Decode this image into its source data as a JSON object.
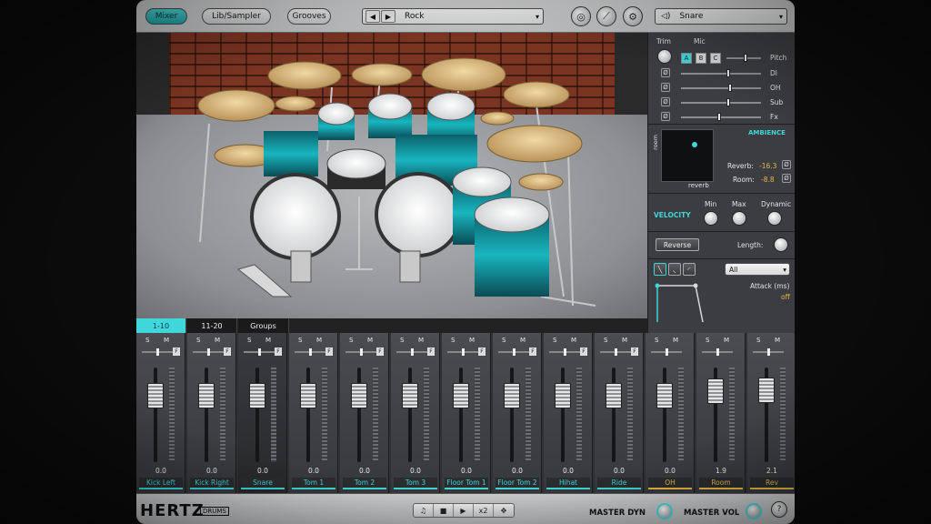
{
  "topbar": {
    "tabs": [
      {
        "label": "Mixer",
        "active": true
      },
      {
        "label": "Lib/Sampler",
        "active": false
      },
      {
        "label": "Grooves",
        "active": false
      }
    ],
    "preset": "Rock",
    "instrument": "Snare"
  },
  "right_panel": {
    "trim_label": "Trim",
    "mic_label": "Mic",
    "mic_buttons": [
      "A",
      "B",
      "C"
    ],
    "sliders": [
      {
        "label": "Pitch",
        "level": 0.55
      },
      {
        "label": "DI",
        "level": 0.6
      },
      {
        "label": "OH",
        "level": 0.62
      },
      {
        "label": "Sub",
        "level": 0.6
      },
      {
        "label": "Fx",
        "level": 0.5
      }
    ],
    "phase_symbol": "Ø",
    "ambience": {
      "title": "AMBIENCE",
      "x_label": "reverb",
      "y_label": "room",
      "reverb_label": "Reverb:",
      "reverb_value": "-16.3",
      "room_label": "Room:",
      "room_value": "-8.8"
    },
    "velocity": {
      "title": "VELOCITY",
      "min_label": "Min",
      "max_label": "Max",
      "dynamic_label": "Dynamic"
    },
    "reverse_label": "Reverse",
    "length_label": "Length:",
    "envelope": {
      "selector": "All",
      "attack_label": "Attack (ms)",
      "attack_value": "off"
    }
  },
  "mixer_tabs": [
    {
      "label": "1-10",
      "active": true
    },
    {
      "label": "11-20",
      "active": false
    },
    {
      "label": "Groups",
      "active": false
    }
  ],
  "channels": [
    {
      "name": "Kick Left",
      "value": "0.0",
      "fader": 0.7
    },
    {
      "name": "Kick Right",
      "value": "0.0",
      "fader": 0.7
    },
    {
      "name": "Snare",
      "value": "0.0",
      "fader": 0.7
    },
    {
      "name": "Tom 1",
      "value": "0.0",
      "fader": 0.7
    },
    {
      "name": "Tom 2",
      "value": "0.0",
      "fader": 0.7
    },
    {
      "name": "Tom 3",
      "value": "0.0",
      "fader": 0.7
    },
    {
      "name": "Floor Tom 1",
      "value": "0.0",
      "fader": 0.7
    },
    {
      "name": "Floor Tom 2",
      "value": "0.0",
      "fader": 0.7
    },
    {
      "name": "Hihat",
      "value": "0.0",
      "fader": 0.7
    },
    {
      "name": "Ride",
      "value": "0.0",
      "fader": 0.7
    },
    {
      "name": "OH",
      "value": "0.0",
      "fader": 0.7
    },
    {
      "name": "Room",
      "value": "1.9",
      "fader": 0.75
    },
    {
      "name": "Rev",
      "value": "2.1",
      "fader": 0.76
    }
  ],
  "strip_labels": {
    "solo": "S",
    "mute": "M",
    "fx": "F"
  },
  "bottombar": {
    "logo": "HERTZ",
    "logo_sub": "DRUMS",
    "transport": [
      "♫",
      "■",
      "▶",
      "x2",
      "✥"
    ],
    "master_dyn_label": "MASTER DYN",
    "master_vol_label": "MASTER VOL"
  },
  "colors": {
    "accent": "#3fd7dc",
    "bus": "#e8b64a"
  }
}
